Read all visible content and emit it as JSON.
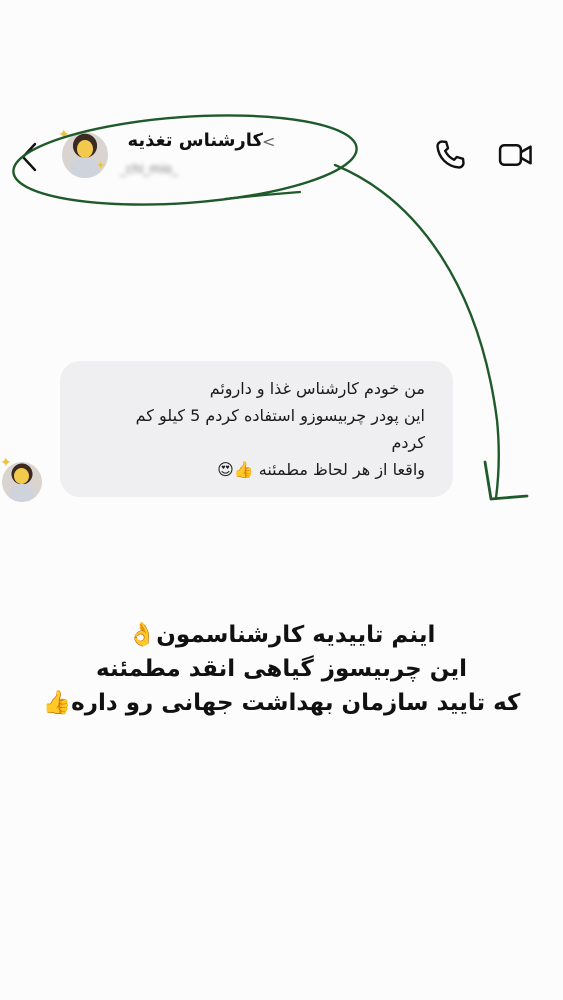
{
  "header": {
    "contact_name": "کارشناس تغذیه",
    "contact_chevron": "<",
    "username": "_chi_mio_",
    "icons": {
      "back": "chevron-left-icon",
      "call": "phone-icon",
      "video": "video-camera-icon"
    }
  },
  "message": {
    "lines": [
      "من خودم کارشناس غذا و داروئم",
      "این پودر چربیسوزو استفاده کردم 5 کیلو کم",
      "کردم",
      "واقعا از هر لحاظ مطمئنه 👍😍"
    ]
  },
  "caption": {
    "lines": [
      "اینم تاییدیه کارشناسمون👌",
      "این چربیسوز گیاهی انقد مطمئنه",
      "که تایید سازمان بهداشت جهانی رو داره👍"
    ]
  },
  "colors": {
    "annotation": "#1f5a2a",
    "bubble": "#efeff2",
    "background": "#fcfcfc"
  }
}
